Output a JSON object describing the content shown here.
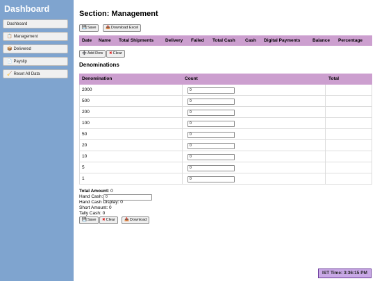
{
  "sidebar": {
    "title": "Dashboard",
    "items": [
      {
        "label": "Dashboard",
        "icon": ""
      },
      {
        "label": "Management",
        "icon": "clipboard-icon"
      },
      {
        "label": "Delivered",
        "icon": "package-icon"
      },
      {
        "label": "Payslip",
        "icon": "document-icon"
      },
      {
        "label": "Reset All Data",
        "icon": "broom-icon"
      }
    ]
  },
  "main": {
    "section_title": "Section: Management",
    "toolbar": {
      "save_label": "Save",
      "download_excel_label": "Download Excel"
    },
    "table_headers": [
      "Date",
      "Name",
      "Total Shipments",
      "Delivery",
      "Failed",
      "Total Cash",
      "Cash",
      "Digital Payments",
      "Balance",
      "Percentage"
    ],
    "row_actions": {
      "add_row_label": "Add Row",
      "clear_label": "Clear"
    },
    "denominations": {
      "title": "Denominations",
      "headers": [
        "Denomination",
        "Count",
        "Total"
      ],
      "rows": [
        {
          "denomination": "2000",
          "count": "0"
        },
        {
          "denomination": "500",
          "count": "0"
        },
        {
          "denomination": "200",
          "count": "0"
        },
        {
          "denomination": "100",
          "count": "0"
        },
        {
          "denomination": "50",
          "count": "0"
        },
        {
          "denomination": "20",
          "count": "0"
        },
        {
          "denomination": "10",
          "count": "0"
        },
        {
          "denomination": "5",
          "count": "0"
        },
        {
          "denomination": "1",
          "count": "0"
        }
      ]
    },
    "summary": {
      "total_amount_label": "Total Amount:",
      "total_amount_value": "0",
      "hand_cash_label": "Hand Cash:",
      "hand_cash_value": "0",
      "hand_cash_display_label": "Hand Cash Display:",
      "hand_cash_display_value": "0",
      "short_amount_label": "Short Amount:",
      "short_amount_value": "0",
      "tally_cash_label": "Tally Cash:",
      "tally_cash_value": "0"
    },
    "bottom_actions": {
      "save_label": "Save",
      "clear_label": "Clear",
      "download_label": "Download"
    },
    "ist_time": "IST Time: 3:36:15 PM"
  },
  "colors": {
    "sidebar_bg": "#7fa4cf",
    "table_header_bg": "#cc9fcf",
    "ist_badge_bg": "#c9a9e6"
  }
}
